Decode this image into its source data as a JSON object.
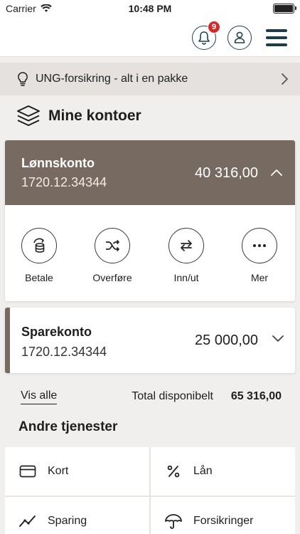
{
  "status_bar": {
    "carrier": "Carrier",
    "time": "10:48 PM"
  },
  "header": {
    "notification_count": "9"
  },
  "promo": {
    "text": "UNG-forsikring - alt i en pakke",
    "icon": "lightbulb-icon"
  },
  "accounts_section": {
    "title": "Mine kontoer",
    "icon": "layers-icon",
    "accounts": [
      {
        "name": "Lønnskonto",
        "number": "1720.12.34344",
        "balance": "40 316,00",
        "expanded": true
      },
      {
        "name": "Sparekonto",
        "number": "1720.12.34344",
        "balance": "25 000,00",
        "expanded": false
      }
    ],
    "actions": [
      {
        "label": "Betale",
        "icon": "coins-refresh-icon"
      },
      {
        "label": "Overføre",
        "icon": "shuffle-icon"
      },
      {
        "label": "Inn/ut",
        "icon": "swap-arrows-icon"
      },
      {
        "label": "Mer",
        "icon": "more-dots-icon"
      }
    ],
    "view_all": "Vis alle",
    "total_label": "Total disponibelt",
    "total_value": "65 316,00"
  },
  "other_services": {
    "title": "Andre tjenester",
    "items": [
      {
        "label": "Kort",
        "icon": "card-icon"
      },
      {
        "label": "Lån",
        "icon": "percent-icon"
      },
      {
        "label": "Sparing",
        "icon": "trend-line-icon"
      },
      {
        "label": "Forsikringer",
        "icon": "umbrella-icon"
      }
    ]
  },
  "colors": {
    "account_header": "#776a61",
    "accent_dark": "#1b3d4a",
    "badge": "#d32a2a",
    "background": "#f1efed"
  }
}
